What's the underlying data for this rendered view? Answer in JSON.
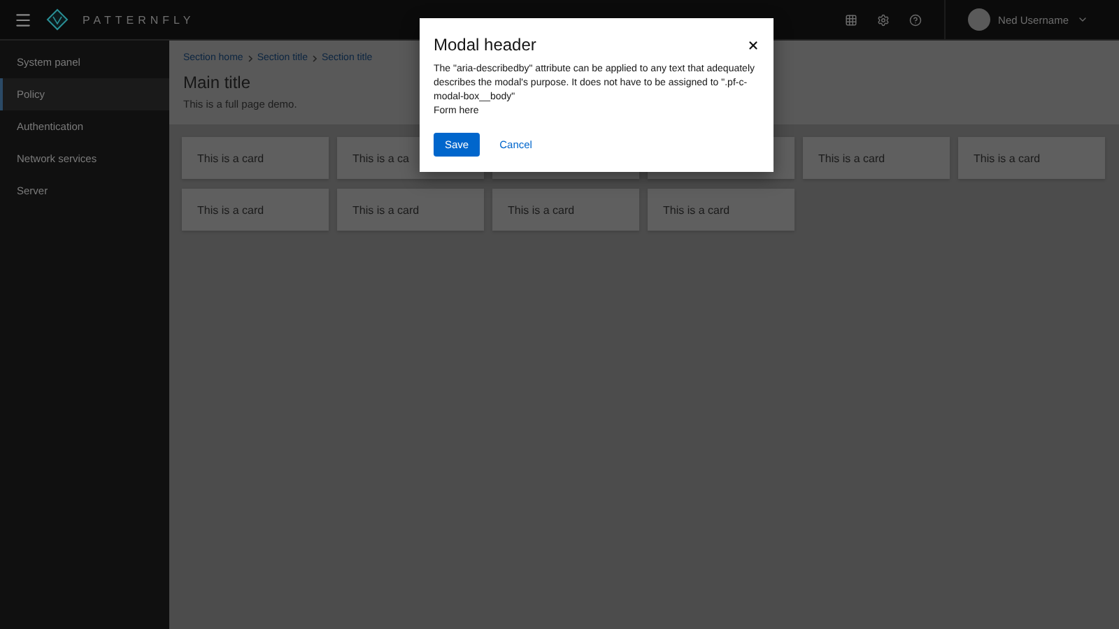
{
  "masthead": {
    "brand": "PATTERNFLY",
    "user": "Ned Username"
  },
  "sidebar": {
    "items": [
      {
        "label": "System panel",
        "selected": false
      },
      {
        "label": "Policy",
        "selected": true
      },
      {
        "label": "Authentication",
        "selected": false
      },
      {
        "label": "Network services",
        "selected": false
      },
      {
        "label": "Server",
        "selected": false
      }
    ]
  },
  "breadcrumb": [
    "Section home",
    "Section title",
    "Section title"
  ],
  "page": {
    "title": "Main title",
    "description": "This is a full page demo."
  },
  "cards_left_of_modal": [
    "This is a card",
    "This is a ca"
  ],
  "cards": [
    "This is a card",
    "This is a card",
    "This is a card",
    "This is a card",
    "This is a card",
    "This is a card"
  ],
  "modal": {
    "title": "Modal header",
    "body": "The \"aria-describedby\" attribute can be applied to any text that adequately describes the modal's purpose. It does not have to be assigned to \".pf-c-modal-box__body\"",
    "form": "Form here",
    "buttons": [
      {
        "label": "Save",
        "kind": "primary"
      },
      {
        "label": "Cancel",
        "kind": "link"
      }
    ]
  }
}
